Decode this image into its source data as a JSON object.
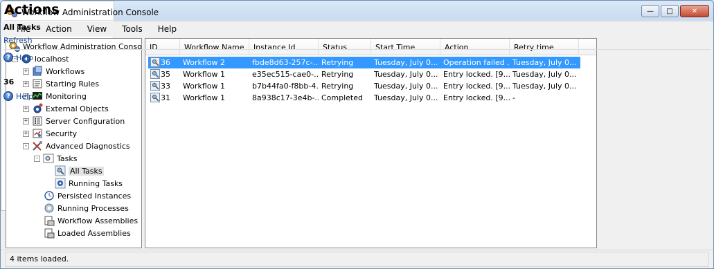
{
  "window": {
    "title": "Workflow Administration Console"
  },
  "menu": [
    "File",
    "Action",
    "View",
    "Tools",
    "Help"
  ],
  "tree": {
    "root": "Workflow Administration Console",
    "host": "localhost",
    "items": [
      "Workflows",
      "Starting Rules",
      "Monitoring",
      "External Objects",
      "Server Configuration",
      "Security",
      "Advanced Diagnostics"
    ],
    "tasks": "Tasks",
    "all_tasks": "All Tasks",
    "running_tasks": "Running Tasks",
    "diag_items": [
      "Persisted Instances",
      "Running Processes",
      "Workflow Assemblies",
      "Loaded Assemblies"
    ]
  },
  "list": {
    "columns": [
      "ID",
      "Workflow Name",
      "Instance Id",
      "Status",
      "Start Time",
      "Action",
      "Retry time"
    ],
    "rows": [
      [
        "36",
        "Workflow 2",
        "fbde8d63-257c-...",
        "Retrying",
        "Tuesday, July 0...",
        "Operation failed ...",
        "Tuesday, July 0..."
      ],
      [
        "35",
        "Workflow 1",
        "e35ec515-cae0-...",
        "Retrying",
        "Tuesday, July 0...",
        "Entry locked. [9...",
        "Tuesday, July 0..."
      ],
      [
        "33",
        "Workflow 1",
        "b7b44fa0-f8bb-4...",
        "Retrying",
        "Tuesday, July 0...",
        "Entry locked. [9...",
        "Tuesday, July 0..."
      ],
      [
        "31",
        "Workflow 1",
        "8a938c17-3e4b-...",
        "Completed",
        "Tuesday, July 0...",
        "Entry locked. [9...",
        "-"
      ]
    ]
  },
  "actions": {
    "title": "Actions",
    "section1": "All Tasks",
    "refresh": "Refresh",
    "help1": "Help",
    "section2": "36",
    "help2": "Help"
  },
  "status": {
    "text": "4 items loaded."
  },
  "colors": {
    "selection": "#3399ff",
    "link": "#1c4f9c"
  }
}
